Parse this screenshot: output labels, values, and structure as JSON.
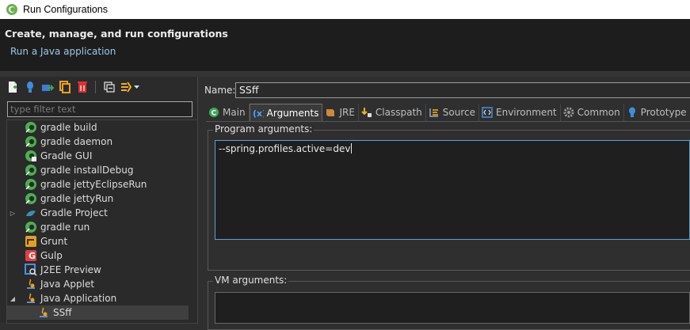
{
  "window": {
    "title": "Run Configurations"
  },
  "header": {
    "title": "Create, manage, and run configurations",
    "subtitle": "Run a Java application"
  },
  "filter": {
    "placeholder": "type filter text"
  },
  "tree": {
    "items": [
      {
        "label": "gradle build",
        "icon": "gradle-icon"
      },
      {
        "label": "gradle daemon",
        "icon": "gradle-icon"
      },
      {
        "label": "Gradle GUI",
        "icon": "gradle-gui-icon"
      },
      {
        "label": "gradle installDebug",
        "icon": "gradle-icon"
      },
      {
        "label": "gradle jettyEclipseRun",
        "icon": "gradle-icon"
      },
      {
        "label": "gradle jettyRun",
        "icon": "gradle-icon"
      },
      {
        "label": "Gradle Project",
        "icon": "gradle-project-icon"
      },
      {
        "label": "gradle run",
        "icon": "gradle-icon"
      },
      {
        "label": "Grunt",
        "icon": "grunt-icon"
      },
      {
        "label": "Gulp",
        "icon": "gulp-icon"
      },
      {
        "label": "J2EE Preview",
        "icon": "j2ee-preview-icon"
      },
      {
        "label": "Java Applet",
        "icon": "java-applet-icon"
      },
      {
        "label": "Java Application",
        "icon": "java-application-icon"
      },
      {
        "label": "SSff",
        "icon": "java-application-icon"
      }
    ]
  },
  "config": {
    "name_label": "Name:",
    "name_value": "SSff",
    "tabs": [
      {
        "label": "Main",
        "icon": "main-tab-icon"
      },
      {
        "label": "Arguments",
        "icon": "arguments-tab-icon"
      },
      {
        "label": "JRE",
        "icon": "jre-tab-icon"
      },
      {
        "label": "Classpath",
        "icon": "classpath-tab-icon"
      },
      {
        "label": "Source",
        "icon": "source-tab-icon"
      },
      {
        "label": "Environment",
        "icon": "environment-tab-icon"
      },
      {
        "label": "Common",
        "icon": "common-tab-icon"
      },
      {
        "label": "Prototype",
        "icon": "prototype-tab-icon"
      }
    ],
    "program_args_label": "Program arguments:",
    "program_args_value": "--spring.profiles.active=dev",
    "vm_args_label": "VM arguments:"
  },
  "colors": {
    "accent": "#5aa0d8",
    "gradle_green": "#4caf50"
  }
}
